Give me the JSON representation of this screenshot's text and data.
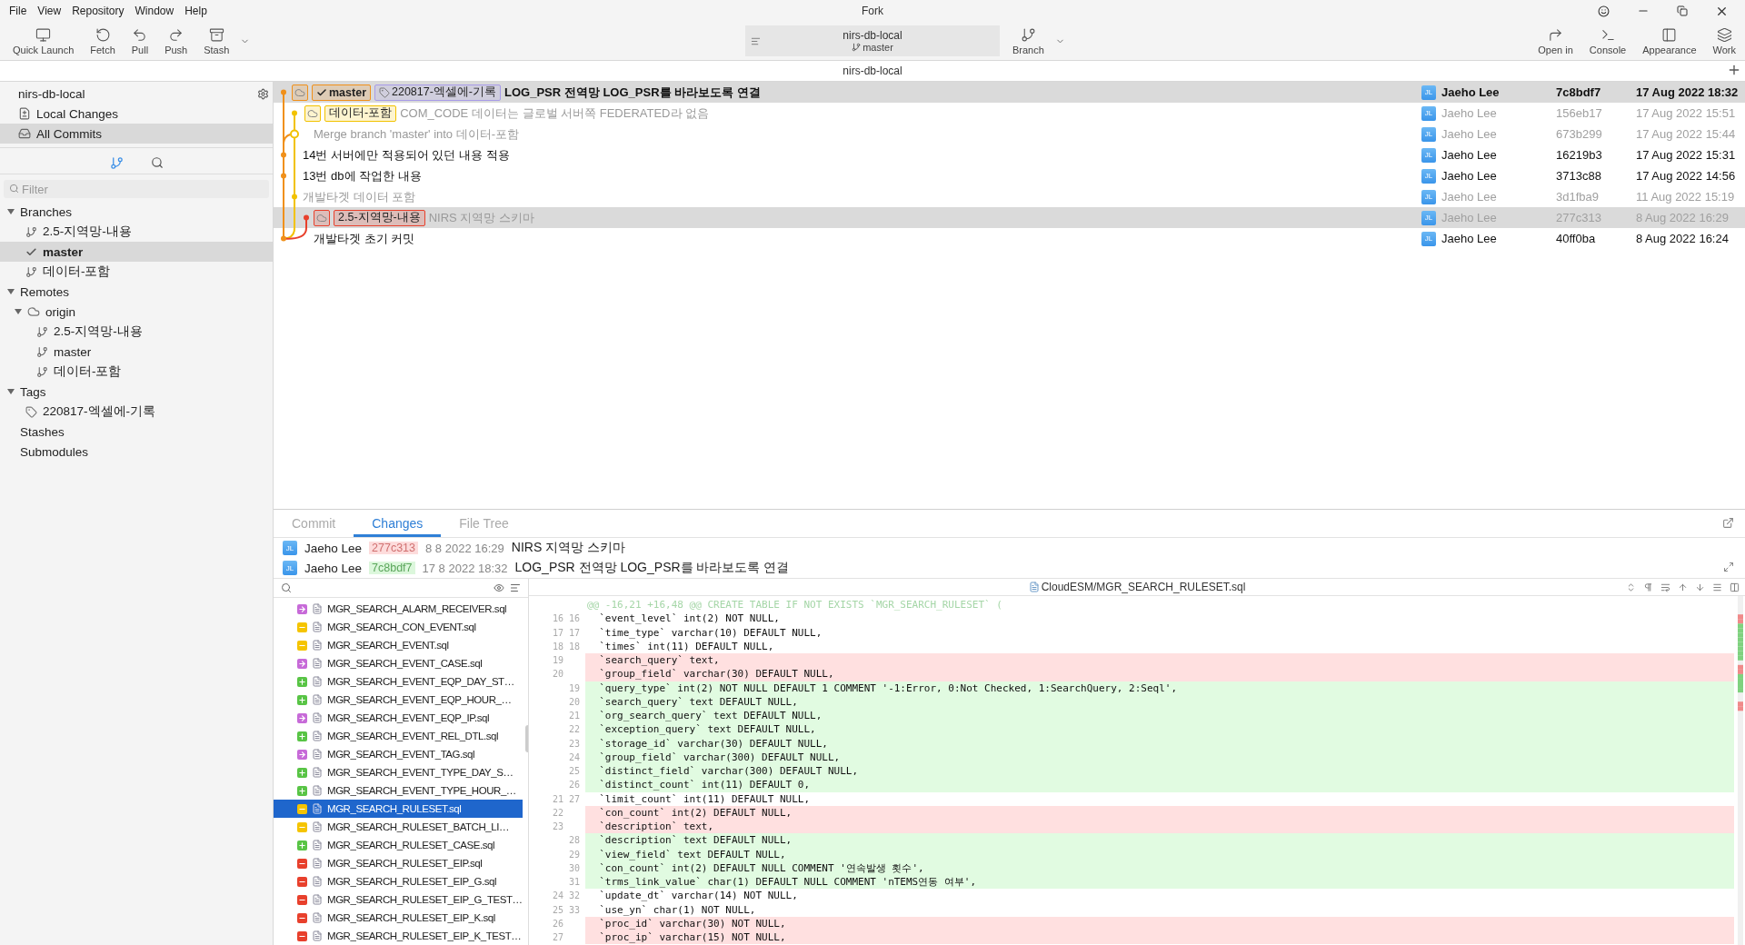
{
  "window": {
    "title": "Fork",
    "menus": [
      "File",
      "View",
      "Repository",
      "Window",
      "Help"
    ]
  },
  "toolbar": {
    "left": [
      {
        "kind": "launch",
        "label": "Quick Launch"
      },
      {
        "kind": "fetch",
        "label": "Fetch"
      },
      {
        "kind": "pull",
        "label": "Pull"
      },
      {
        "kind": "push",
        "label": "Push"
      },
      {
        "kind": "stash",
        "label": "Stash"
      }
    ],
    "repo": {
      "name": "nirs-db-local",
      "branch": "master"
    },
    "branch_button": "Branch",
    "right": [
      {
        "kind": "open",
        "label": "Open in"
      },
      {
        "kind": "console",
        "label": "Console"
      },
      {
        "kind": "appearance",
        "label": "Appearance"
      },
      {
        "kind": "work",
        "label": "Work"
      }
    ]
  },
  "repo_tab": "nirs-db-local",
  "sidebar": {
    "repo": "nirs-db-local",
    "views": [
      {
        "kind": "local",
        "label": "Local Changes",
        "selected": false
      },
      {
        "kind": "all",
        "label": "All Commits",
        "selected": true
      }
    ],
    "filter": {
      "placeholder": "Filter"
    },
    "tree": [
      {
        "kind": "group",
        "label": "Branches",
        "expanded": true,
        "children": [
          {
            "kind": "branch",
            "label": "2.5-지역망-내용",
            "current": false,
            "selected": false
          },
          {
            "kind": "branch",
            "label": "master",
            "current": true,
            "selected": true
          },
          {
            "kind": "branch",
            "label": "데이터-포함",
            "current": false,
            "selected": false
          }
        ]
      },
      {
        "kind": "group",
        "label": "Remotes",
        "expanded": true,
        "children": [
          {
            "kind": "remote",
            "label": "origin",
            "expanded": true,
            "children": [
              {
                "kind": "branch",
                "label": "2.5-지역망-내용"
              },
              {
                "kind": "branch",
                "label": "master"
              },
              {
                "kind": "branch",
                "label": "데이터-포함"
              }
            ]
          }
        ]
      },
      {
        "kind": "group",
        "label": "Tags",
        "expanded": true,
        "children": [
          {
            "kind": "tag",
            "label": "220817-엑셀에-기록"
          }
        ]
      },
      {
        "kind": "plain",
        "label": "Stashes"
      },
      {
        "kind": "plain",
        "label": "Submodules"
      }
    ]
  },
  "commits": [
    {
      "refs": [
        {
          "kind": "remote",
          "color": "#f0901a"
        },
        {
          "kind": "branch",
          "label": "master",
          "current": true,
          "color": "#f0901a"
        },
        {
          "kind": "tag",
          "label": "220817-엑셀에-기록",
          "color": "#a79be8"
        }
      ],
      "message": "LOG_PSR 전역망 LOG_PSR를 바라보도록 연결",
      "avatar": "JL",
      "author": "Jaeho Lee",
      "hash": "7c8bdf7",
      "date": "17 Aug 2022 18:32",
      "head": true,
      "dimmed": false,
      "selected": true
    },
    {
      "refs": [
        {
          "kind": "remote",
          "color": "#f2c200"
        },
        {
          "kind": "branch",
          "label": "데이터-포함",
          "current": false,
          "color": "#f2c200"
        }
      ],
      "message": "COM_CODE 데이터는 글로벌 서버쪽 FEDERATED라 없음",
      "avatar": "JL",
      "author": "Jaeho Lee",
      "hash": "156eb17",
      "date": "17 Aug 2022 15:51",
      "head": false,
      "dimmed": true,
      "selected": false
    },
    {
      "message": "Merge branch 'master' into 데이터-포함",
      "avatar": "JL",
      "author": "Jaeho Lee",
      "hash": "673b299",
      "date": "17 Aug 2022 15:44",
      "head": false,
      "dimmed": true,
      "selected": false
    },
    {
      "message": "14번 서버에만 적용되어 있던 내용 적용",
      "avatar": "JL",
      "author": "Jaeho Lee",
      "hash": "16219b3",
      "date": "17 Aug 2022 15:31",
      "head": false,
      "dimmed": false,
      "selected": false
    },
    {
      "message": "13번 db에 작업한 내용",
      "avatar": "JL",
      "author": "Jaeho Lee",
      "hash": "3713c88",
      "date": "17 Aug 2022 14:56",
      "head": false,
      "dimmed": false,
      "selected": false
    },
    {
      "message": "개발타겟 데이터 포함",
      "avatar": "JL",
      "author": "Jaeho Lee",
      "hash": "3d1fba9",
      "date": "11 Aug 2022 15:19",
      "head": false,
      "dimmed": true,
      "selected": false
    },
    {
      "refs": [
        {
          "kind": "remote",
          "color": "#e8402c"
        },
        {
          "kind": "branch",
          "label": "2.5-지역망-내용",
          "current": false,
          "color": "#e8402c"
        }
      ],
      "message": "NIRS 지역망 스키마",
      "avatar": "JL",
      "author": "Jaeho Lee",
      "hash": "277c313",
      "date": "8 Aug 2022 16:29",
      "head": false,
      "dimmed": true,
      "selected": true
    },
    {
      "message": "개발타겟 초기 커밋",
      "avatar": "JL",
      "author": "Jaeho Lee",
      "hash": "40ff0ba",
      "date": "8 Aug 2022 16:24",
      "head": false,
      "dimmed": false,
      "selected": false
    }
  ],
  "details": {
    "tabs": [
      {
        "label": "Commit",
        "selected": false
      },
      {
        "label": "Changes",
        "selected": true
      },
      {
        "label": "File Tree",
        "selected": false
      }
    ],
    "compare": [
      {
        "kind": "old",
        "avatar": "JL",
        "author": "Jaeho Lee",
        "hash": "277c313",
        "date": "8 8 2022 16:29",
        "subject": "NIRS 지역망 스키마"
      },
      {
        "kind": "new",
        "avatar": "JL",
        "author": "Jaeho Lee",
        "hash": "7c8bdf7",
        "date": "17 8 2022 18:32",
        "subject": "LOG_PSR 전역망 LOG_PSR를 바라보도록 연결"
      }
    ],
    "files": [
      {
        "kind": "renamed",
        "name": "MGR_SEARCH_ALARM_RECEIVER.sql",
        "selected": false
      },
      {
        "kind": "modified",
        "name": "MGR_SEARCH_CON_EVENT.sql",
        "selected": false
      },
      {
        "kind": "modified",
        "name": "MGR_SEARCH_EVENT.sql",
        "selected": false
      },
      {
        "kind": "renamed",
        "name": "MGR_SEARCH_EVENT_CASE.sql",
        "selected": false
      },
      {
        "kind": "added",
        "name": "MGR_SEARCH_EVENT_EQP_DAY_ST…",
        "selected": false
      },
      {
        "kind": "added",
        "name": "MGR_SEARCH_EVENT_EQP_HOUR_…",
        "selected": false
      },
      {
        "kind": "renamed",
        "name": "MGR_SEARCH_EVENT_EQP_IP.sql",
        "selected": false
      },
      {
        "kind": "added",
        "name": "MGR_SEARCH_EVENT_REL_DTL.sql",
        "selected": false
      },
      {
        "kind": "renamed",
        "name": "MGR_SEARCH_EVENT_TAG.sql",
        "selected": false
      },
      {
        "kind": "added",
        "name": "MGR_SEARCH_EVENT_TYPE_DAY_S…",
        "selected": false
      },
      {
        "kind": "added",
        "name": "MGR_SEARCH_EVENT_TYPE_HOUR_…",
        "selected": false
      },
      {
        "kind": "modified",
        "name": "MGR_SEARCH_RULESET.sql",
        "selected": true
      },
      {
        "kind": "modified",
        "name": "MGR_SEARCH_RULESET_BATCH_LI…",
        "selected": false
      },
      {
        "kind": "added",
        "name": "MGR_SEARCH_RULESET_CASE.sql",
        "selected": false
      },
      {
        "kind": "deleted",
        "name": "MGR_SEARCH_RULESET_EIP.sql",
        "selected": false
      },
      {
        "kind": "deleted",
        "name": "MGR_SEARCH_RULESET_EIP_G.sql",
        "selected": false
      },
      {
        "kind": "deleted",
        "name": "MGR_SEARCH_RULESET_EIP_G_TEST…",
        "selected": false
      },
      {
        "kind": "deleted",
        "name": "MGR_SEARCH_RULESET_EIP_K.sql",
        "selected": false
      },
      {
        "kind": "deleted",
        "name": "MGR_SEARCH_RULESET_EIP_K_TEST…",
        "selected": false
      }
    ],
    "diff": {
      "path": "CloudESM/MGR_SEARCH_RULESET.sql",
      "lines": [
        {
          "kind": "hunk",
          "text": "@@ -16,21 +16,48 @@ CREATE TABLE IF NOT EXISTS `MGR_SEARCH_RULESET` ("
        },
        {
          "kind": "context",
          "old": "16",
          "new": "16",
          "text": "  `event_level` int(2) NOT NULL,"
        },
        {
          "kind": "context",
          "old": "17",
          "new": "17",
          "text": "  `time_type` varchar(10) DEFAULT NULL,"
        },
        {
          "kind": "context",
          "old": "18",
          "new": "18",
          "text": "  `times` int(11) DEFAULT NULL,"
        },
        {
          "kind": "removed",
          "old": "19",
          "text": "  `search_query` text,"
        },
        {
          "kind": "removed",
          "old": "20",
          "text": "  `group_field` varchar(30) DEFAULT NULL,"
        },
        {
          "kind": "added",
          "new": "19",
          "text": "  `query_type` int(2) NOT NULL DEFAULT 1 COMMENT '-1:Error, 0:Not Checked, 1:SearchQuery, 2:Seql',"
        },
        {
          "kind": "added",
          "new": "20",
          "text": "  `search_query` text DEFAULT NULL,"
        },
        {
          "kind": "added",
          "new": "21",
          "text": "  `org_search_query` text DEFAULT NULL,"
        },
        {
          "kind": "added",
          "new": "22",
          "text": "  `exception_query` text DEFAULT NULL,"
        },
        {
          "kind": "added",
          "new": "23",
          "text": "  `storage_id` varchar(30) DEFAULT NULL,"
        },
        {
          "kind": "added",
          "new": "24",
          "text": "  `group_field` varchar(300) DEFAULT NULL,"
        },
        {
          "kind": "added",
          "new": "25",
          "text": "  `distinct_field` varchar(300) DEFAULT NULL,"
        },
        {
          "kind": "added",
          "new": "26",
          "text": "  `distinct_count` int(11) DEFAULT 0,"
        },
        {
          "kind": "context",
          "old": "21",
          "new": "27",
          "text": "  `limit_count` int(11) DEFAULT NULL,"
        },
        {
          "kind": "removed",
          "old": "22",
          "text": "  `con_count` int(2) DEFAULT NULL,"
        },
        {
          "kind": "removed",
          "old": "23",
          "text": "  `description` text,"
        },
        {
          "kind": "added",
          "new": "28",
          "text": "  `description` text DEFAULT NULL,"
        },
        {
          "kind": "added",
          "new": "29",
          "text": "  `view_field` text DEFAULT NULL,"
        },
        {
          "kind": "added",
          "new": "30",
          "text": "  `con_count` int(2) DEFAULT NULL COMMENT '연속발생 횟수',"
        },
        {
          "kind": "added",
          "new": "31",
          "text": "  `trms_link_value` char(1) DEFAULT NULL COMMENT 'nTEMS연동 여부',"
        },
        {
          "kind": "context",
          "old": "24",
          "new": "32",
          "text": "  `update_dt` varchar(14) NOT NULL,"
        },
        {
          "kind": "context",
          "old": "25",
          "new": "33",
          "text": "  `use_yn` char(1) NOT NULL,"
        },
        {
          "kind": "removed",
          "old": "26",
          "text": "  `proc_id` varchar(30) NOT NULL,"
        },
        {
          "kind": "removed",
          "old": "27",
          "text": "  `proc_ip` varchar(15) NOT NULL,"
        }
      ]
    }
  }
}
